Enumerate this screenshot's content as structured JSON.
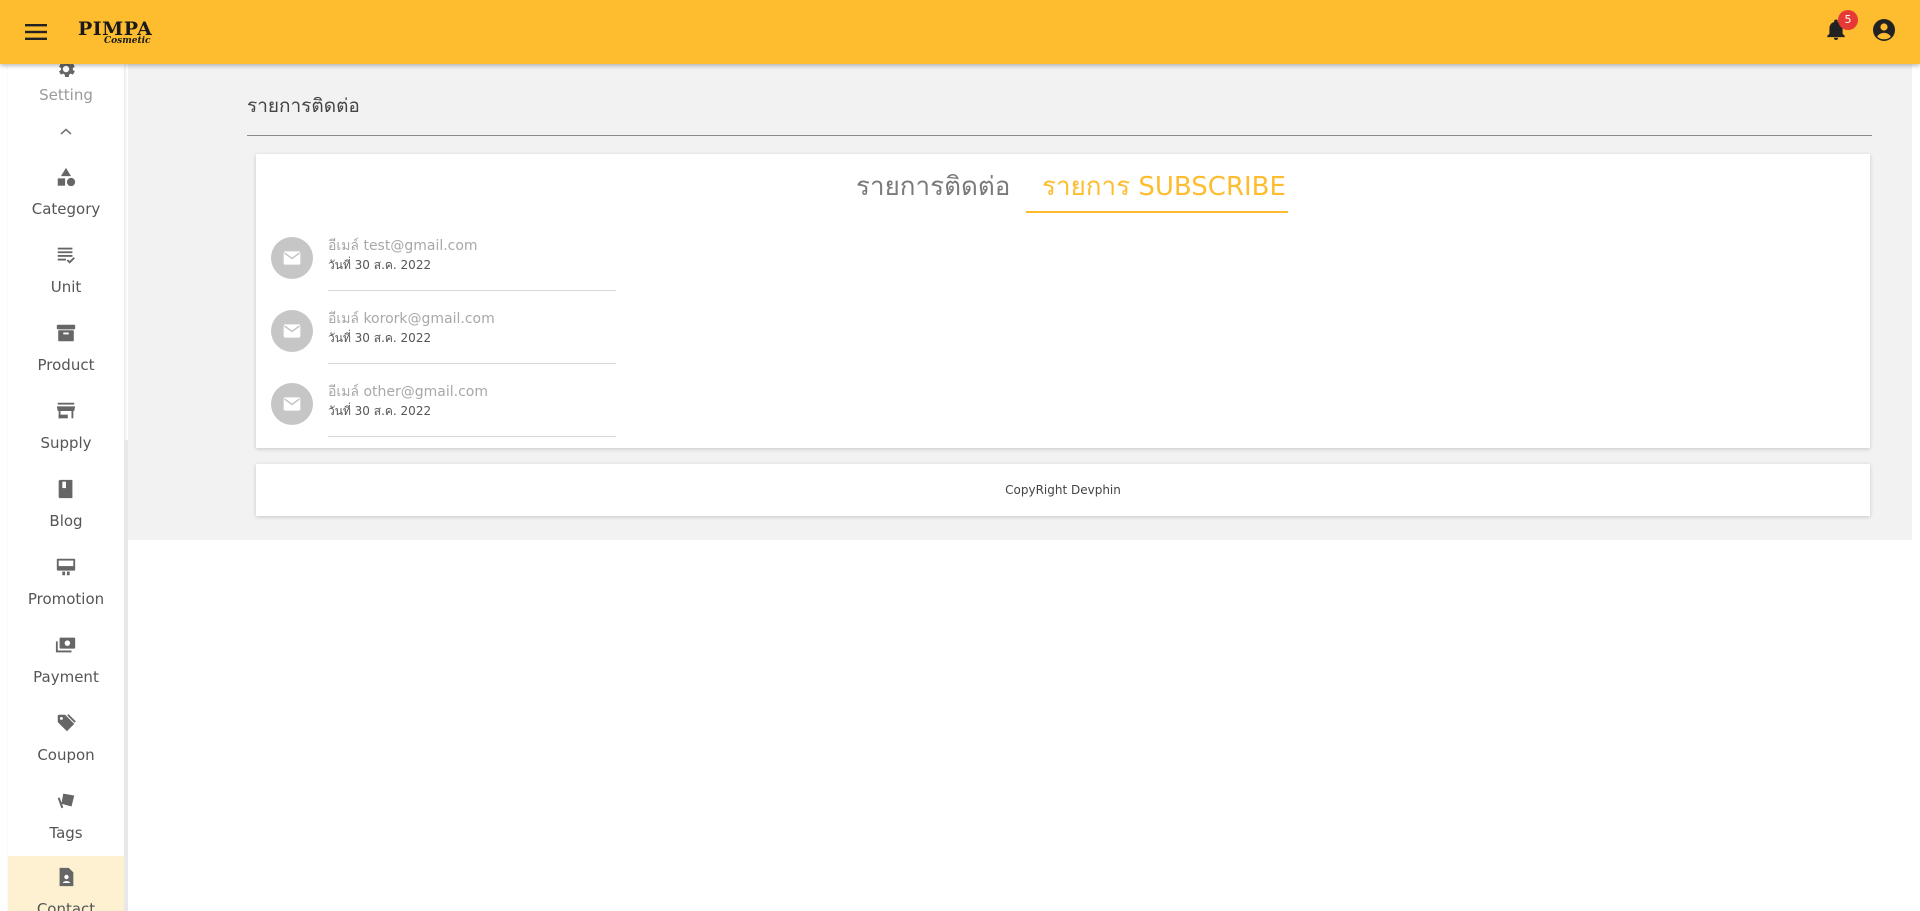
{
  "app": {
    "logo_text": "PIMPA",
    "logo_subtext": "Cosmetic",
    "notification_count": "5",
    "accent_color": "#fdbd2f",
    "icons": {
      "menu": "hamburger-menu-icon",
      "notifications": "bell-icon",
      "profile": "account-circle-icon"
    }
  },
  "sidebar": {
    "setting": {
      "label": "Setting",
      "icon": "gear-icon"
    },
    "collapse_icon": "chevron-up-icon",
    "items": [
      {
        "label": "Category",
        "icon": "shapes-icon"
      },
      {
        "label": "Unit",
        "icon": "checklist-icon"
      },
      {
        "label": "Product",
        "icon": "archive-box-icon"
      },
      {
        "label": "Supply",
        "icon": "storefront-icon"
      },
      {
        "label": "Blog",
        "icon": "book-icon"
      },
      {
        "label": "Promotion",
        "icon": "monitor-icon"
      },
      {
        "label": "Payment",
        "icon": "cash-icon"
      },
      {
        "label": "Coupon",
        "icon": "tag-icon"
      },
      {
        "label": "Tags",
        "icon": "tags-icon"
      },
      {
        "label": "Contact",
        "icon": "contact-card-icon",
        "active": true
      }
    ]
  },
  "main": {
    "page_title": "รายการติดต่อ",
    "tabs": [
      {
        "label": "รายการติดต่อ",
        "active": false
      },
      {
        "label": "รายการ SUBSCRIBE",
        "active": true
      }
    ],
    "subscribers": [
      {
        "email": "อีเมล์ test@gmail.com",
        "date": "วันที่ 30 ส.ค. 2022"
      },
      {
        "email": "อีเมล์ korork@gmail.com",
        "date": "วันที่ 30 ส.ค. 2022"
      },
      {
        "email": "อีเมล์ other@gmail.com",
        "date": "วันที่ 30 ส.ค. 2022"
      }
    ]
  },
  "footer": {
    "text": "CopyRight Devphin"
  }
}
